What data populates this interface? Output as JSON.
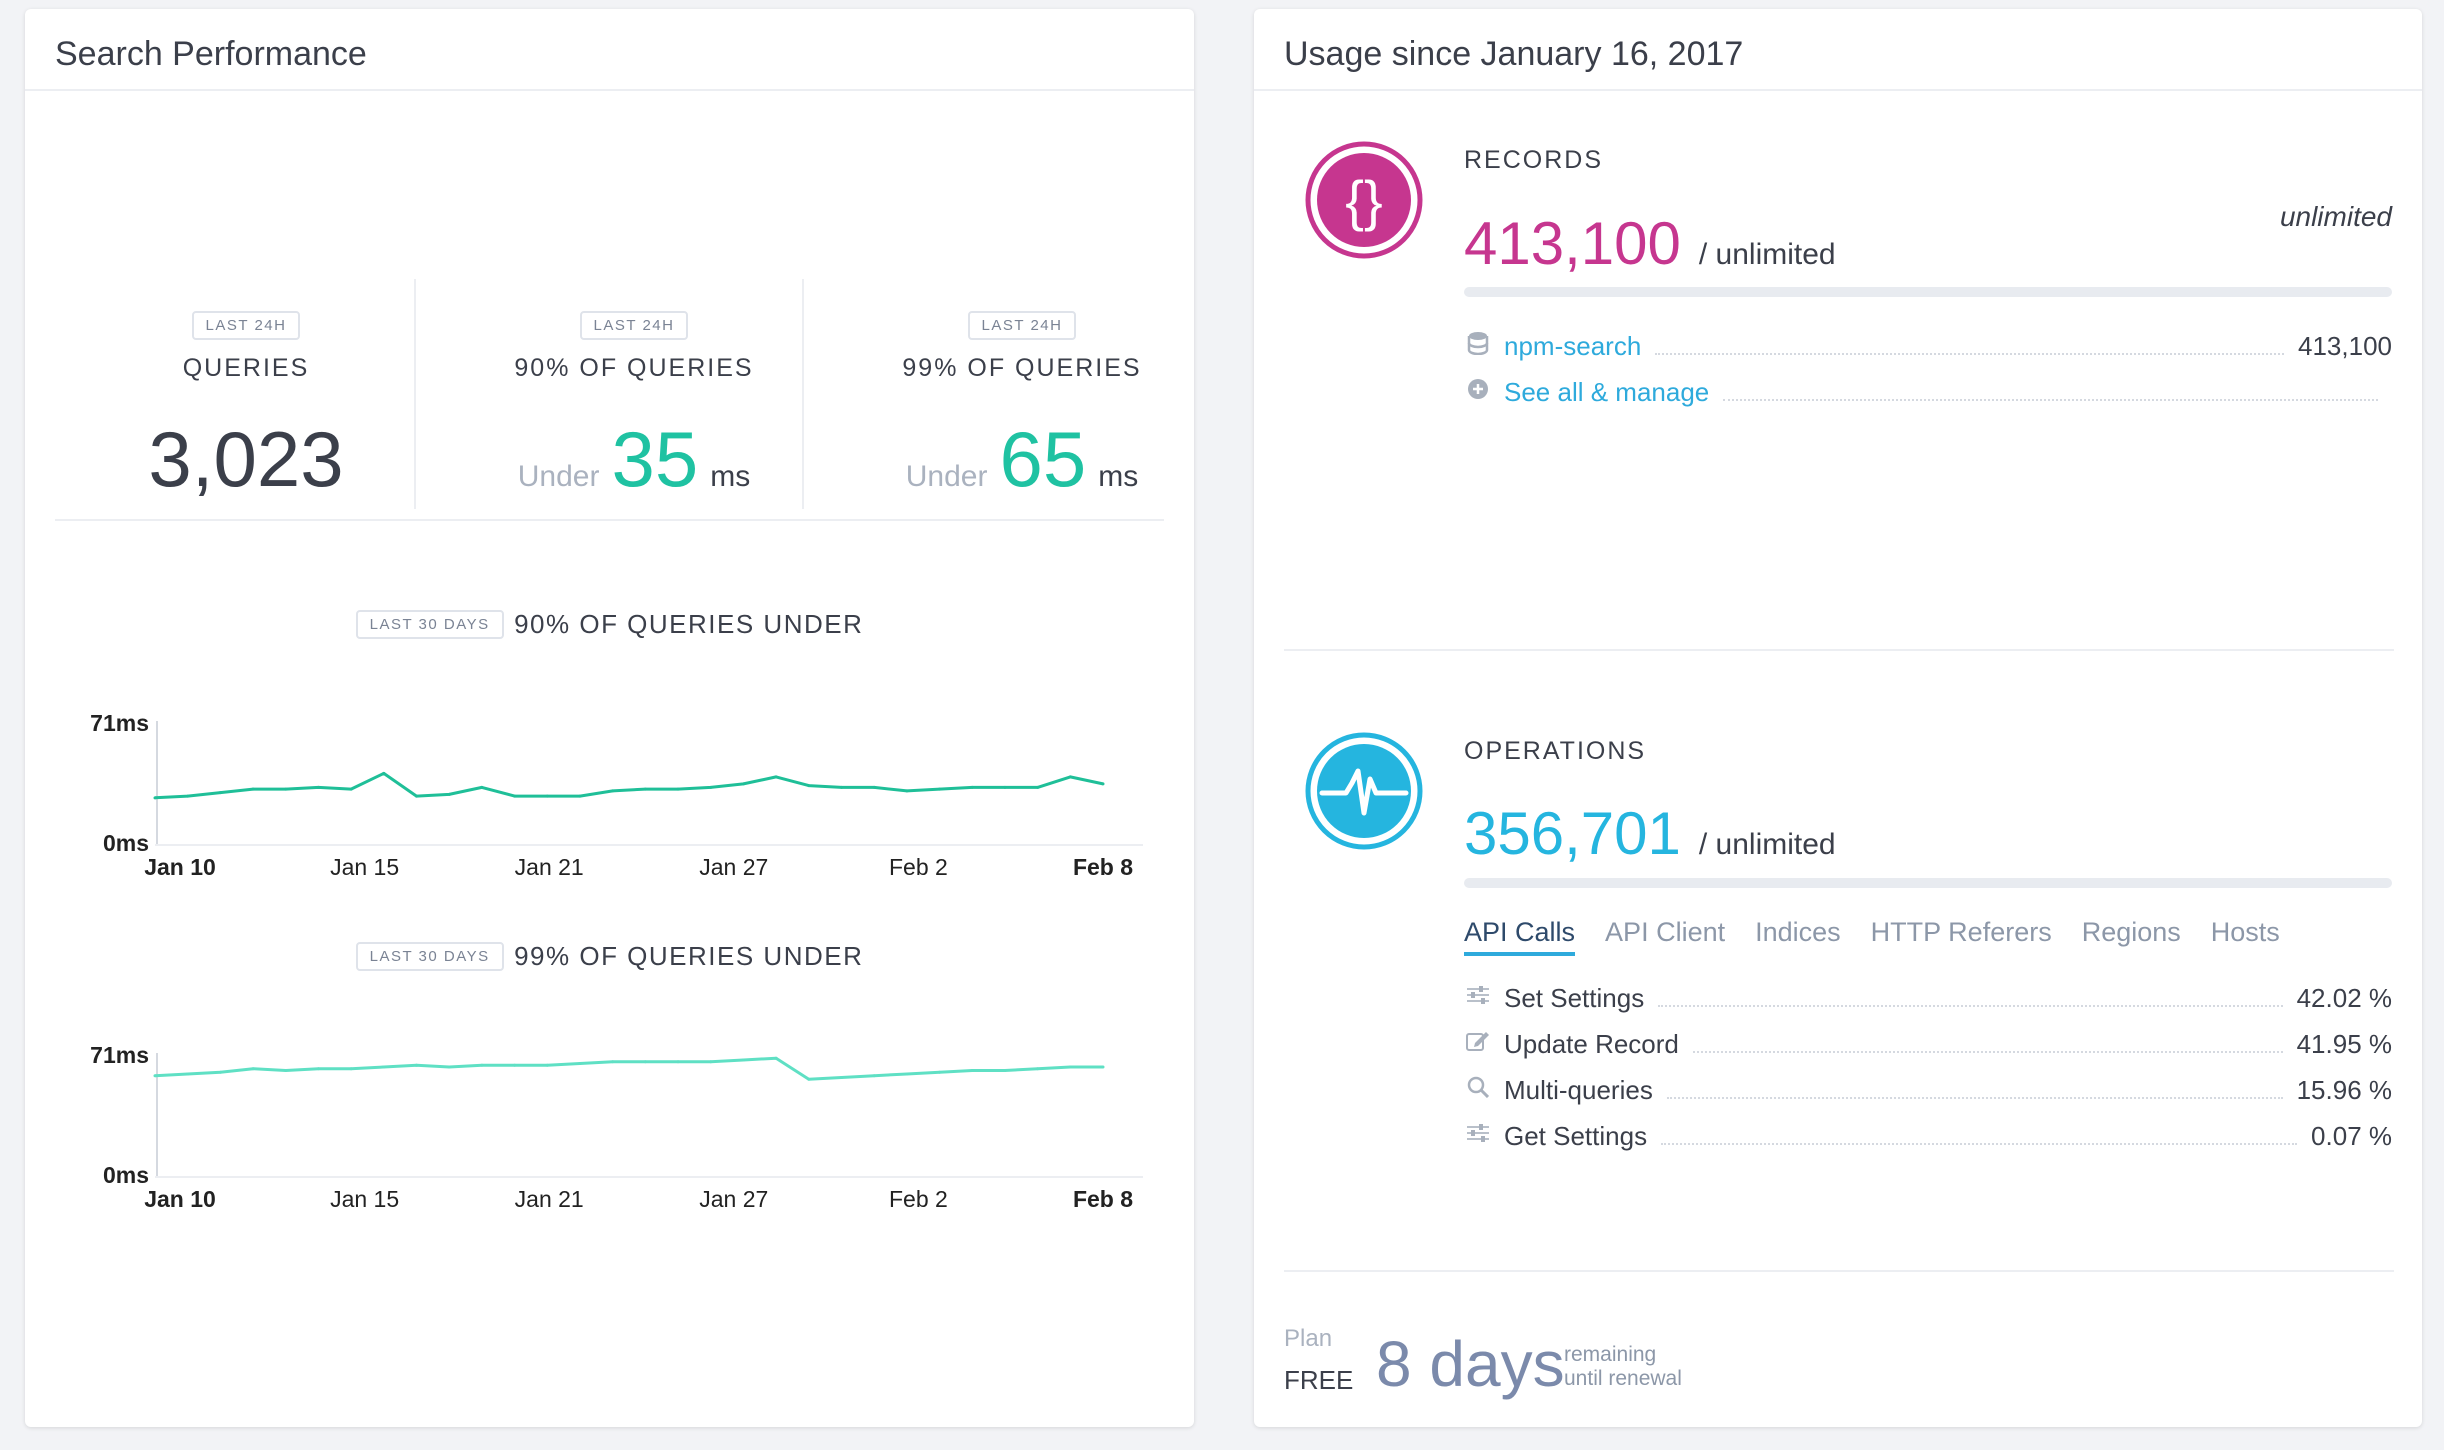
{
  "left": {
    "title": "Search Performance",
    "kpis": [
      {
        "badge": "LAST 24H",
        "label": "QUERIES",
        "value": "3,023"
      },
      {
        "badge": "LAST 24H",
        "label": "90% OF QUERIES",
        "under": "Under",
        "value": "35",
        "unit": "ms"
      },
      {
        "badge": "LAST 24H",
        "label": "99% OF QUERIES",
        "under": "Under",
        "value": "65",
        "unit": "ms"
      }
    ]
  },
  "chart_data": [
    {
      "type": "line",
      "badge": "LAST 30 DAYS",
      "title": "90% OF QUERIES UNDER",
      "ylim": [
        0,
        71
      ],
      "ytick_labels": [
        "71ms",
        "0ms"
      ],
      "xtick_labels": [
        "Jan 10",
        "Jan 15",
        "Jan 21",
        "Jan 27",
        "Feb 2",
        "Feb 8"
      ],
      "x": [
        "Jan 10",
        "Jan 11",
        "Jan 12",
        "Jan 13",
        "Jan 14",
        "Jan 15",
        "Jan 16",
        "Jan 17",
        "Jan 18",
        "Jan 19",
        "Jan 20",
        "Jan 21",
        "Jan 22",
        "Jan 23",
        "Jan 24",
        "Jan 25",
        "Jan 26",
        "Jan 27",
        "Jan 28",
        "Jan 29",
        "Jan 30",
        "Jan 31",
        "Feb 1",
        "Feb 2",
        "Feb 3",
        "Feb 4",
        "Feb 5",
        "Feb 6",
        "Feb 7",
        "Feb 8"
      ],
      "values": [
        27,
        28,
        30,
        32,
        32,
        33,
        32,
        41,
        28,
        29,
        33,
        28,
        28,
        28,
        31,
        32,
        32,
        33,
        35,
        39,
        34,
        33,
        33,
        31,
        32,
        33,
        33,
        33,
        39,
        35
      ],
      "color": "#1fbf98",
      "grid": false
    },
    {
      "type": "line",
      "badge": "LAST 30 DAYS",
      "title": "99% OF QUERIES UNDER",
      "ylim": [
        0,
        71
      ],
      "ytick_labels": [
        "71ms",
        "0ms"
      ],
      "xtick_labels": [
        "Jan 10",
        "Jan 15",
        "Jan 21",
        "Jan 27",
        "Feb 2",
        "Feb 8"
      ],
      "x": [
        "Jan 10",
        "Jan 11",
        "Jan 12",
        "Jan 13",
        "Jan 14",
        "Jan 15",
        "Jan 16",
        "Jan 17",
        "Jan 18",
        "Jan 19",
        "Jan 20",
        "Jan 21",
        "Jan 22",
        "Jan 23",
        "Jan 24",
        "Jan 25",
        "Jan 26",
        "Jan 27",
        "Jan 28",
        "Jan 29",
        "Jan 30",
        "Jan 31",
        "Feb 1",
        "Feb 2",
        "Feb 3",
        "Feb 4",
        "Feb 5",
        "Feb 6",
        "Feb 7",
        "Feb 8"
      ],
      "values": [
        58,
        59,
        60,
        62,
        61,
        62,
        62,
        63,
        64,
        63,
        64,
        64,
        64,
        65,
        66,
        66,
        66,
        66,
        67,
        68,
        56,
        57,
        58,
        59,
        60,
        61,
        61,
        62,
        63,
        63
      ],
      "color": "#5fe0c4",
      "grid": false
    }
  ],
  "right": {
    "title": "Usage since January 16, 2017",
    "records": {
      "icon": "braces-icon",
      "color": "#c6368f",
      "title": "RECORDS",
      "value": "413,100",
      "limit": "/ unlimited",
      "limit_right": "unlimited",
      "fill": 0,
      "rows": [
        {
          "icon": "database-icon",
          "label": "npm-search",
          "value": "413,100"
        },
        {
          "icon": "plus-circle-icon",
          "label": "See all & manage",
          "value": ""
        }
      ]
    },
    "operations": {
      "icon": "pulse-icon",
      "color": "#25b5df",
      "title": "OPERATIONS",
      "value": "356,701",
      "limit": "/ unlimited",
      "fill": 0,
      "tabs": [
        "API Calls",
        "API Client",
        "Indices",
        "HTTP Referers",
        "Regions",
        "Hosts"
      ],
      "active_tab": "API Calls",
      "rows": [
        {
          "icon": "sliders-icon",
          "label": "Set Settings",
          "value": "42.02 %"
        },
        {
          "icon": "edit-icon",
          "label": "Update Record",
          "value": "41.95 %"
        },
        {
          "icon": "search-icon",
          "label": "Multi-queries",
          "value": "15.96 %"
        },
        {
          "icon": "sliders-icon",
          "label": "Get Settings",
          "value": "0.07 %"
        }
      ]
    },
    "plan": {
      "plan_label": "Plan",
      "plan_name": "FREE",
      "days": "8 days",
      "remaining": "remaining",
      "until": "until renewal"
    }
  }
}
